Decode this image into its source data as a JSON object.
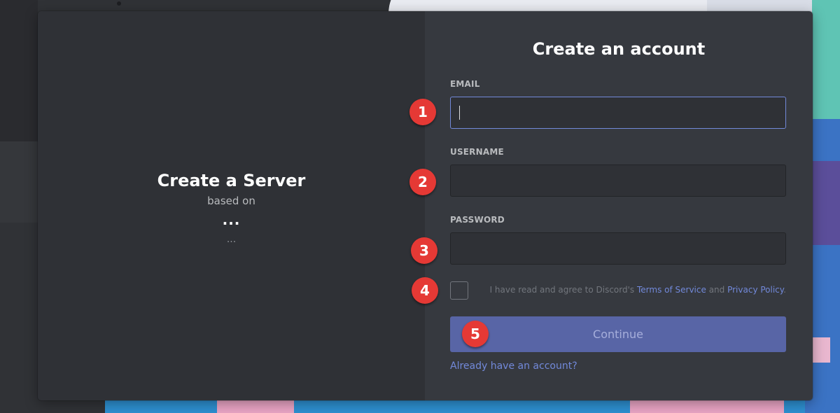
{
  "left_panel": {
    "title": "Create a Server",
    "subtitle": "based on",
    "server_name": "...",
    "server_meta": "..."
  },
  "form": {
    "title": "Create an account",
    "email_label": "EMAIL",
    "email_value": "",
    "username_label": "USERNAME",
    "username_value": "",
    "password_label": "PASSWORD",
    "password_value": "",
    "tos_prefix": "I have read and agree to Discord's ",
    "tos_link": "Terms of Service",
    "tos_and": " and ",
    "privacy_link": "Privacy Policy",
    "tos_suffix": ".",
    "tos_checked": false,
    "continue_label": "Continue",
    "login_link": "Already have an account?"
  },
  "steps": [
    "1",
    "2",
    "3",
    "4",
    "5"
  ],
  "colors": {
    "accent": "#7289da",
    "button": "#5865a6",
    "badge": "#e53935",
    "panel_left": "#2f3136",
    "panel_right": "#36393f"
  }
}
